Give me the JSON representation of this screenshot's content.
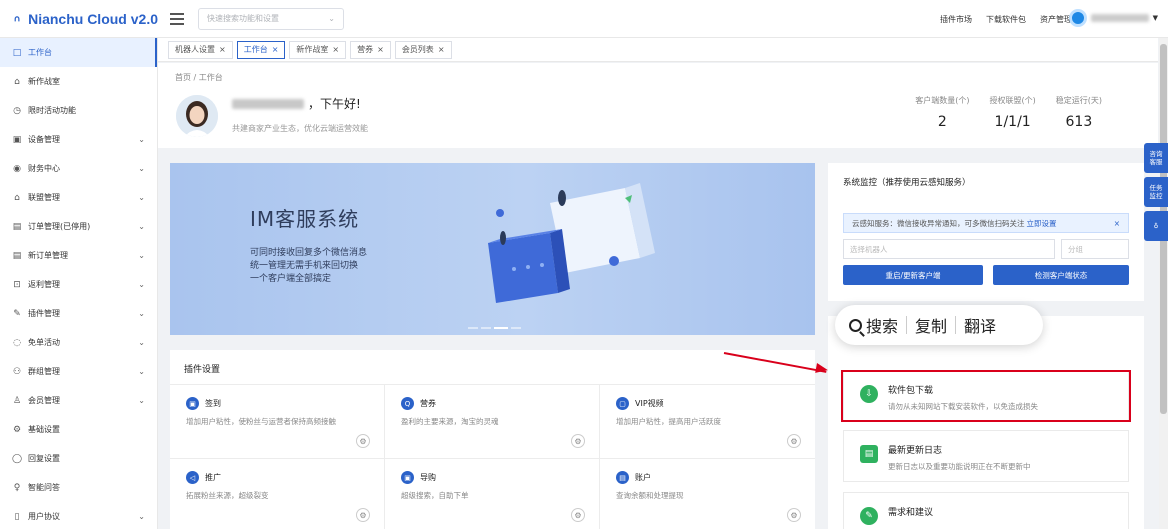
{
  "app": {
    "logo_text": "Nianchu Cloud v2.0",
    "search_placeholder": "快速搜索功能和设置",
    "top_links": [
      "插件市场",
      "下载软件包",
      "资产管理"
    ]
  },
  "sidebar": {
    "items": [
      {
        "label": "工作台",
        "icon": "□",
        "active": true,
        "expandable": false
      },
      {
        "label": "新作战室",
        "icon": "⌂",
        "active": false,
        "expandable": false
      },
      {
        "label": "限时活动功能",
        "icon": "◷",
        "active": false,
        "expandable": false
      },
      {
        "label": "设备管理",
        "icon": "▣",
        "active": false,
        "expandable": true
      },
      {
        "label": "财务中心",
        "icon": "◉",
        "active": false,
        "expandable": true
      },
      {
        "label": "联盟管理",
        "icon": "⌂",
        "active": false,
        "expandable": true
      },
      {
        "label": "订单管理(已停用)",
        "icon": "▤",
        "active": false,
        "expandable": true
      },
      {
        "label": "新订单管理",
        "icon": "▤",
        "active": false,
        "expandable": true
      },
      {
        "label": "返利管理",
        "icon": "⊡",
        "active": false,
        "expandable": true
      },
      {
        "label": "插件管理",
        "icon": "✎",
        "active": false,
        "expandable": true
      },
      {
        "label": "免单活动",
        "icon": "◌",
        "active": false,
        "expandable": true
      },
      {
        "label": "群组管理",
        "icon": "⚇",
        "active": false,
        "expandable": true
      },
      {
        "label": "会员管理",
        "icon": "♙",
        "active": false,
        "expandable": true
      },
      {
        "label": "基础设置",
        "icon": "⚙",
        "active": false,
        "expandable": false
      },
      {
        "label": "回复设置",
        "icon": "◯",
        "active": false,
        "expandable": false
      },
      {
        "label": "智能问答",
        "icon": "♀",
        "active": false,
        "expandable": false
      },
      {
        "label": "用户协议",
        "icon": "▯",
        "active": false,
        "expandable": true
      }
    ]
  },
  "tabs": [
    {
      "label": "机器人设置",
      "active": false
    },
    {
      "label": "工作台",
      "active": true
    },
    {
      "label": "新作战室",
      "active": false
    },
    {
      "label": "营券",
      "active": false
    },
    {
      "label": "会员列表",
      "active": false
    }
  ],
  "header": {
    "breadcrumb": "首页 / 工作台",
    "greeting": "，下午好!",
    "subtitle": "共建商家产业生态，优化云端运营效能",
    "stats": [
      {
        "label": "客户端数量(个)",
        "value": "2"
      },
      {
        "label": "授权联盟(个)",
        "value": "1/1/1"
      },
      {
        "label": "稳定运行(天)",
        "value": "613"
      }
    ]
  },
  "banner": {
    "title": "IM客服系统",
    "lines": [
      "可同时接收回复多个微信消息",
      "统一管理无需手机来回切换",
      "一个客户端全部搞定"
    ]
  },
  "plugins": {
    "title": "插件设置",
    "items": [
      {
        "name": "签到",
        "desc": "增加用户粘性，使粉丝与运营者保持高频接触",
        "icon": "▣"
      },
      {
        "name": "营券",
        "desc": "盈利的主要来源，淘宝的灵魂",
        "icon": "Q"
      },
      {
        "name": "VIP视频",
        "desc": "增加用户粘性，提高用户活跃度",
        "icon": "▢"
      },
      {
        "name": "推广",
        "desc": "拓展粉丝来源，超级裂变",
        "icon": "◁"
      },
      {
        "name": "导购",
        "desc": "超级搜索，自助下单",
        "icon": "▣"
      },
      {
        "name": "账户",
        "desc": "查询余额和处理提现",
        "icon": "▤"
      }
    ]
  },
  "monitor": {
    "title": "系统监控（推荐使用云感知服务）",
    "notice_text": "云感知服务：微信接收异常通知，可多微信扫码关注",
    "notice_link": "立即设置",
    "robot_placeholder": "选择机器人",
    "group_placeholder": "分组",
    "restart_button": "重启/更新客户端",
    "check_button": "检测客户端状态"
  },
  "popup": {
    "search": "搜索",
    "copy": "复制",
    "translate": "翻译"
  },
  "right_cards": [
    {
      "title": "软件包下载",
      "desc": "请勿从未知网站下载安装软件，以免造成损失",
      "icon": "⇩"
    },
    {
      "title": "最新更新日志",
      "desc": "更新日志以及重要功能说明正在不断更新中",
      "icon": "▤"
    },
    {
      "title": "需求和建议",
      "desc": "",
      "icon": "✎"
    }
  ],
  "float_buttons": [
    {
      "label": "咨询\n客服"
    },
    {
      "label": "任务\n监控"
    },
    {
      "label": "♁"
    }
  ],
  "colors": {
    "accent": "#2b62c9",
    "highlight": "#d9001b",
    "card_icon": "#2fb15f"
  }
}
